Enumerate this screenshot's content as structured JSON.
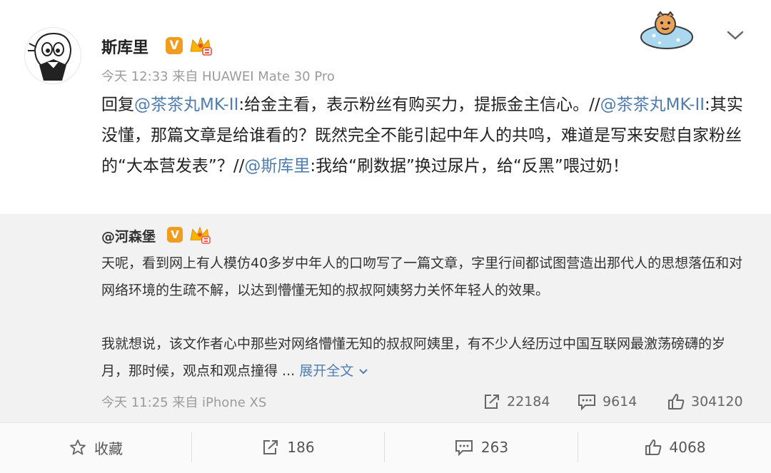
{
  "post": {
    "author": "斯库里",
    "verified_badge": "V",
    "meta": "今天 12:33 来自 HUAWEI Mate 30 Pro",
    "reply_segments": [
      {
        "text": "回复",
        "link": false
      },
      {
        "text": "@茶茶丸MK-II",
        "link": true
      },
      {
        "text": ":给金主看，表示粉丝有购买力，提振金主信心。//",
        "link": false
      },
      {
        "text": "@茶茶丸MK-II",
        "link": true
      },
      {
        "text": ":其实没懂，那篇文章是给谁看的？既然完全不能引起中年人的共鸣，难道是写来安慰自家粉丝的“大本营发表”？//",
        "link": false
      },
      {
        "text": "@斯库里",
        "link": true
      },
      {
        "text": ":我给“刷数据”换过尿片，给“反黑”喂过奶！",
        "link": false
      }
    ]
  },
  "quoted": {
    "author": "@河森堡",
    "verified_badge": "V",
    "paragraph1": "天呢，看到网上有人模仿40多岁中年人的口吻写了一篇文章，字里行间都试图营造出那代人的思想落伍和对网络环境的生疏不解，以达到懵懂无知的叔叔阿姨努力关怀年轻人的效果。",
    "paragraph2": "我就想说，该文作者心中那些对网络懵懂无知的叔叔阿姨里，有不少人经历过中国互联网最激荡磅礴的岁月，那时候，观点和观点撞得 ... ",
    "expand_label": "展开全文",
    "meta": "今天 11:25 来自 iPhone XS",
    "stats": {
      "reposts": "22184",
      "comments": "9614",
      "likes": "304120"
    }
  },
  "actions": {
    "favorite_label": "收藏",
    "repost_count": "186",
    "comment_count": "263",
    "like_count": "4068"
  },
  "colors": {
    "link": "#507daf",
    "badge": "#f09d1f",
    "quote_bg": "#f2f2f2"
  }
}
